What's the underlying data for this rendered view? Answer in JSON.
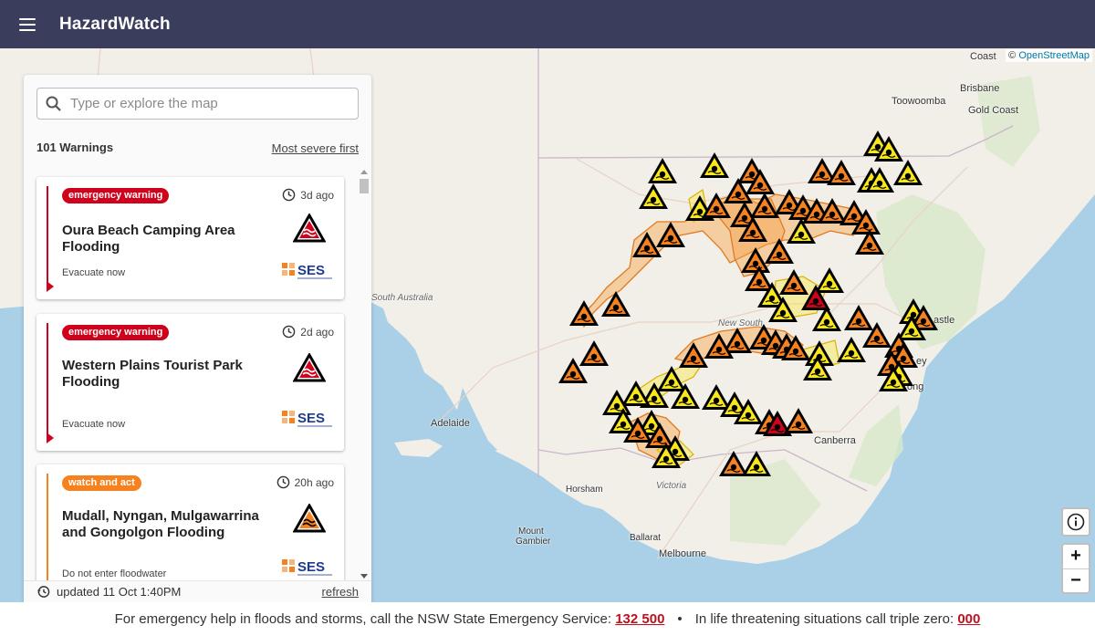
{
  "app": {
    "title": "HazardWatch"
  },
  "map": {
    "attribution_prefix": "©",
    "attribution_link": "OpenStreetMap",
    "labels": {
      "coast": "Coast",
      "brisbane": "Brisbane",
      "toowoomba": "Toowoomba",
      "gold_coast": "Gold Coast",
      "south_australia": "South Australia",
      "new_south": "New South",
      "adelaide": "Adelaide",
      "canberra": "Canberra",
      "horsham": "Horsham",
      "victoria": "Victoria",
      "mount_gambier_1": "Mount",
      "mount_gambier_2": "Gambier",
      "ballarat": "Ballarat",
      "melbourne": "Melbourne",
      "newcastle": "astle",
      "sydney": "ey",
      "wollongong": "ong"
    },
    "controls": {
      "zoom_in": "+",
      "zoom_out": "−",
      "info_icon": "info-icon"
    }
  },
  "panel": {
    "search_placeholder": "Type or explore the map",
    "warning_count": "101 Warnings",
    "sort_label": "Most severe first",
    "cards": [
      {
        "badge": "emergency warning",
        "age": "3d ago",
        "title": "Oura Beach Camping Area Flooding",
        "action": "Evacuate now",
        "color": "#d0021b",
        "agency_logo": "SES"
      },
      {
        "badge": "emergency warning",
        "age": "2d ago",
        "title": "Western Plains Tourist Park Flooding",
        "action": "Evacuate now",
        "color": "#d0021b",
        "agency_logo": "SES"
      },
      {
        "badge": "watch and act",
        "age": "20h ago",
        "title": "Mudall, Nyngan, Mulgawarrina and Gongolgon Flooding",
        "action": "Do not enter floodwater",
        "color": "#f5821f",
        "agency_logo": "SES"
      }
    ],
    "updated": "updated 11 Oct 1:40PM",
    "refresh": "refresh"
  },
  "footer": {
    "text_1": "For emergency help in floods and storms, call the NSW State Emergency Service:",
    "phone_1": "132 500",
    "separator": "•",
    "text_2": "In life threatening situations call triple zero:",
    "phone_2": "000"
  },
  "colors": {
    "topbar": "#3a3d5c",
    "emergency": "#d0021b",
    "watch_act": "#f5821f",
    "advice": "#f8e71c"
  }
}
